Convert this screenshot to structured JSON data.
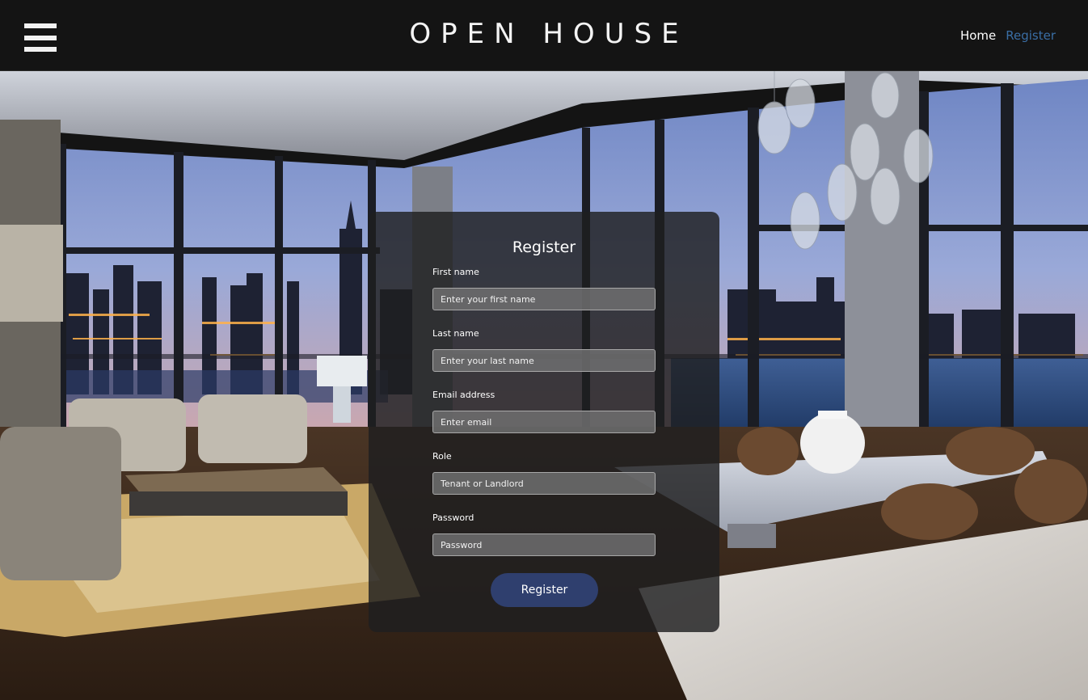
{
  "header": {
    "brand": "OPEN HOUSE",
    "nav": {
      "home": "Home",
      "register": "Register"
    }
  },
  "form": {
    "title": "Register",
    "fields": [
      {
        "label": "First name",
        "placeholder": "Enter your first name"
      },
      {
        "label": "Last name",
        "placeholder": "Enter your last name"
      },
      {
        "label": "Email address",
        "placeholder": "Enter email"
      },
      {
        "label": "Role",
        "placeholder": "Tenant or Landlord"
      },
      {
        "label": "Password",
        "placeholder": "Password"
      }
    ],
    "submit_label": "Register"
  },
  "icons": {
    "menu": "hamburger-menu-icon"
  },
  "colors": {
    "header_bg": "#141414",
    "nav_active": "#3a6ea5",
    "button_bg": "#2f3f6e"
  }
}
